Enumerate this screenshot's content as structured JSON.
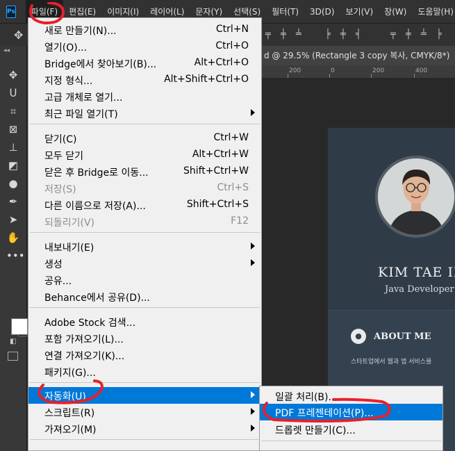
{
  "app": {
    "logo": "Ps"
  },
  "menubar": [
    "파일(F)",
    "편집(E)",
    "이미지(I)",
    "레이어(L)",
    "문자(Y)",
    "선택(S)",
    "필터(T)",
    "3D(D)",
    "보기(V)",
    "창(W)",
    "도움말(H)"
  ],
  "document_tab": "d @ 29.5% (Rectangle 3 copy 복사, CMYK/8*)",
  "ruler_ticks": [
    "200",
    "0",
    "200",
    "400"
  ],
  "file_menu": {
    "items": [
      {
        "label": "새로 만들기(N)...",
        "shortcut": "Ctrl+N"
      },
      {
        "label": "열기(O)...",
        "shortcut": "Ctrl+O"
      },
      {
        "label": "Bridge에서 찾아보기(B)...",
        "shortcut": "Alt+Ctrl+O"
      },
      {
        "label": "지정 형식...",
        "shortcut": "Alt+Shift+Ctrl+O"
      },
      {
        "label": "고급 개체로 열기...",
        "shortcut": ""
      },
      {
        "label": "최근 파일 열기(T)",
        "shortcut": ""
      },
      {
        "label": "닫기(C)",
        "shortcut": "Ctrl+W"
      },
      {
        "label": "모두 닫기",
        "shortcut": "Alt+Ctrl+W"
      },
      {
        "label": "닫은 후 Bridge로 이동...",
        "shortcut": "Shift+Ctrl+W"
      },
      {
        "label": "저장(S)",
        "shortcut": "Ctrl+S"
      },
      {
        "label": "다른 이름으로 저장(A)...",
        "shortcut": "Shift+Ctrl+S"
      },
      {
        "label": "되돌리기(V)",
        "shortcut": "F12"
      },
      {
        "label": "내보내기(E)",
        "shortcut": ""
      },
      {
        "label": "생성",
        "shortcut": ""
      },
      {
        "label": "공유...",
        "shortcut": ""
      },
      {
        "label": "Behance에서 공유(D)...",
        "shortcut": ""
      },
      {
        "label": "Adobe Stock 검색...",
        "shortcut": ""
      },
      {
        "label": "포함 가져오기(L)...",
        "shortcut": ""
      },
      {
        "label": "연결 가져오기(K)...",
        "shortcut": ""
      },
      {
        "label": "패키지(G)...",
        "shortcut": ""
      },
      {
        "label": "자동화(U)",
        "shortcut": ""
      },
      {
        "label": "스크립트(R)",
        "shortcut": ""
      },
      {
        "label": "가져오기(M)",
        "shortcut": ""
      }
    ]
  },
  "automate_submenu": {
    "items": [
      {
        "label": "일괄 처리(B)..."
      },
      {
        "label": "PDF 프레젠테이션(P)..."
      },
      {
        "label": "드롭렛 만들기(C)..."
      }
    ]
  },
  "artboard": {
    "name": "KIM TAE IN",
    "role": "Java Developer",
    "about_title": "ABOUT ME",
    "about_text": "스타트업에서 웹과 앱 서비스를"
  },
  "colors": {
    "menu_highlight": "#0078d7",
    "annotation": "#e8202a",
    "foreground": "#ffffff",
    "background": "#111111"
  }
}
